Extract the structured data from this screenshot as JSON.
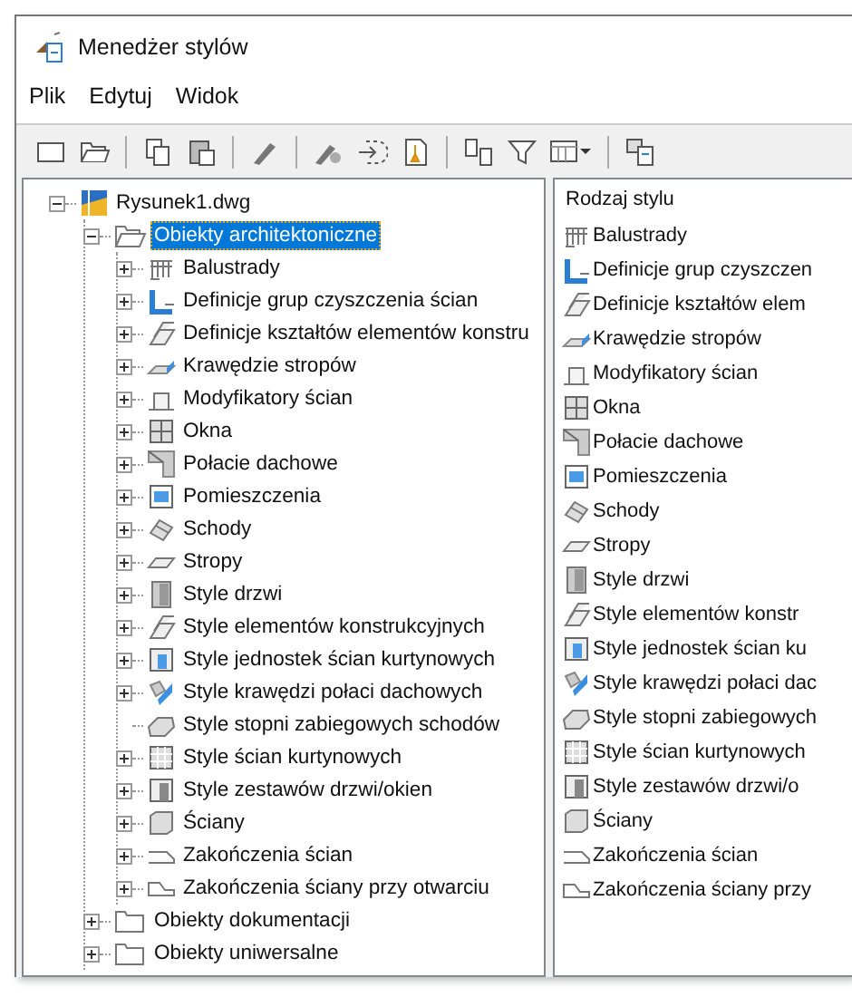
{
  "window": {
    "title": "Menedżer stylów"
  },
  "menu": [
    "Plik",
    "Edytuj",
    "Widok"
  ],
  "tree": [
    {
      "label": "Rysunek1.dwg",
      "expanded": true,
      "selected": false,
      "children": [
        {
          "label": "Obiekty architektoniczne",
          "expanded": true,
          "selected": true,
          "children": [
            {
              "label": "Balustrady",
              "expanded": false,
              "selected": false
            },
            {
              "label": "Definicje grup czyszczenia ścian",
              "expanded": false,
              "selected": false
            },
            {
              "label": "Definicje kształtów elementów konstru",
              "expanded": false,
              "selected": false
            },
            {
              "label": "Krawędzie stropów",
              "expanded": false,
              "selected": false
            },
            {
              "label": "Modyfikatory ścian",
              "expanded": false,
              "selected": false
            },
            {
              "label": "Okna",
              "expanded": false,
              "selected": false
            },
            {
              "label": "Połacie dachowe",
              "expanded": false,
              "selected": false
            },
            {
              "label": "Pomieszczenia",
              "expanded": false,
              "selected": false
            },
            {
              "label": "Schody",
              "expanded": false,
              "selected": false
            },
            {
              "label": "Stropy",
              "expanded": false,
              "selected": false
            },
            {
              "label": "Style drzwi",
              "expanded": false,
              "selected": false
            },
            {
              "label": "Style elementów konstrukcyjnych",
              "expanded": false,
              "selected": false
            },
            {
              "label": "Style jednostek ścian kurtynowych",
              "expanded": false,
              "selected": false
            },
            {
              "label": "Style krawędzi połaci dachowych",
              "expanded": false,
              "selected": false
            },
            {
              "label": "Style stopni zabiegowych schodów",
              "selected": false
            },
            {
              "label": "Style ścian kurtynowych",
              "expanded": false,
              "selected": false
            },
            {
              "label": "Style zestawów drzwi/okien",
              "expanded": false,
              "selected": false
            },
            {
              "label": "Ściany",
              "expanded": false,
              "selected": false
            },
            {
              "label": "Zakończenia ścian",
              "expanded": false,
              "selected": false
            },
            {
              "label": "Zakończenia ściany przy otwarciu",
              "expanded": false,
              "selected": false
            }
          ]
        },
        {
          "label": "Obiekty dokumentacji",
          "expanded": false,
          "selected": false
        },
        {
          "label": "Obiekty uniwersalne",
          "expanded": false,
          "selected": false
        }
      ]
    }
  ],
  "list": {
    "header": "Rodzaj stylu",
    "items": [
      "Balustrady",
      "Definicje grup czyszczen",
      "Definicje kształtów elem",
      "Krawędzie stropów",
      "Modyfikatory ścian",
      "Okna",
      "Połacie dachowe",
      "Pomieszczenia",
      "Schody",
      "Stropy",
      "Style drzwi",
      "Style elementów konstr",
      "Style jednostek ścian ku",
      "Style krawędzi połaci dac",
      "Style stopni zabiegowych",
      "Style ścian kurtynowych",
      "Style zestawów drzwi/o",
      "Ściany",
      "Zakończenia ścian",
      "Zakończenia ściany przy"
    ]
  }
}
